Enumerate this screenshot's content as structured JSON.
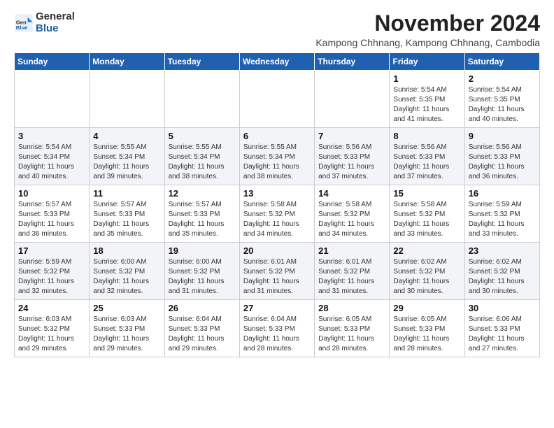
{
  "logo": {
    "general": "General",
    "blue": "Blue"
  },
  "header": {
    "month": "November 2024",
    "location": "Kampong Chhnang, Kampong Chhnang, Cambodia"
  },
  "weekdays": [
    "Sunday",
    "Monday",
    "Tuesday",
    "Wednesday",
    "Thursday",
    "Friday",
    "Saturday"
  ],
  "weeks": [
    [
      {
        "day": "",
        "info": ""
      },
      {
        "day": "",
        "info": ""
      },
      {
        "day": "",
        "info": ""
      },
      {
        "day": "",
        "info": ""
      },
      {
        "day": "",
        "info": ""
      },
      {
        "day": "1",
        "info": "Sunrise: 5:54 AM\nSunset: 5:35 PM\nDaylight: 11 hours and 41 minutes."
      },
      {
        "day": "2",
        "info": "Sunrise: 5:54 AM\nSunset: 5:35 PM\nDaylight: 11 hours and 40 minutes."
      }
    ],
    [
      {
        "day": "3",
        "info": "Sunrise: 5:54 AM\nSunset: 5:34 PM\nDaylight: 11 hours and 40 minutes."
      },
      {
        "day": "4",
        "info": "Sunrise: 5:55 AM\nSunset: 5:34 PM\nDaylight: 11 hours and 39 minutes."
      },
      {
        "day": "5",
        "info": "Sunrise: 5:55 AM\nSunset: 5:34 PM\nDaylight: 11 hours and 38 minutes."
      },
      {
        "day": "6",
        "info": "Sunrise: 5:55 AM\nSunset: 5:34 PM\nDaylight: 11 hours and 38 minutes."
      },
      {
        "day": "7",
        "info": "Sunrise: 5:56 AM\nSunset: 5:33 PM\nDaylight: 11 hours and 37 minutes."
      },
      {
        "day": "8",
        "info": "Sunrise: 5:56 AM\nSunset: 5:33 PM\nDaylight: 11 hours and 37 minutes."
      },
      {
        "day": "9",
        "info": "Sunrise: 5:56 AM\nSunset: 5:33 PM\nDaylight: 11 hours and 36 minutes."
      }
    ],
    [
      {
        "day": "10",
        "info": "Sunrise: 5:57 AM\nSunset: 5:33 PM\nDaylight: 11 hours and 36 minutes."
      },
      {
        "day": "11",
        "info": "Sunrise: 5:57 AM\nSunset: 5:33 PM\nDaylight: 11 hours and 35 minutes."
      },
      {
        "day": "12",
        "info": "Sunrise: 5:57 AM\nSunset: 5:33 PM\nDaylight: 11 hours and 35 minutes."
      },
      {
        "day": "13",
        "info": "Sunrise: 5:58 AM\nSunset: 5:32 PM\nDaylight: 11 hours and 34 minutes."
      },
      {
        "day": "14",
        "info": "Sunrise: 5:58 AM\nSunset: 5:32 PM\nDaylight: 11 hours and 34 minutes."
      },
      {
        "day": "15",
        "info": "Sunrise: 5:58 AM\nSunset: 5:32 PM\nDaylight: 11 hours and 33 minutes."
      },
      {
        "day": "16",
        "info": "Sunrise: 5:59 AM\nSunset: 5:32 PM\nDaylight: 11 hours and 33 minutes."
      }
    ],
    [
      {
        "day": "17",
        "info": "Sunrise: 5:59 AM\nSunset: 5:32 PM\nDaylight: 11 hours and 32 minutes."
      },
      {
        "day": "18",
        "info": "Sunrise: 6:00 AM\nSunset: 5:32 PM\nDaylight: 11 hours and 32 minutes."
      },
      {
        "day": "19",
        "info": "Sunrise: 6:00 AM\nSunset: 5:32 PM\nDaylight: 11 hours and 31 minutes."
      },
      {
        "day": "20",
        "info": "Sunrise: 6:01 AM\nSunset: 5:32 PM\nDaylight: 11 hours and 31 minutes."
      },
      {
        "day": "21",
        "info": "Sunrise: 6:01 AM\nSunset: 5:32 PM\nDaylight: 11 hours and 31 minutes."
      },
      {
        "day": "22",
        "info": "Sunrise: 6:02 AM\nSunset: 5:32 PM\nDaylight: 11 hours and 30 minutes."
      },
      {
        "day": "23",
        "info": "Sunrise: 6:02 AM\nSunset: 5:32 PM\nDaylight: 11 hours and 30 minutes."
      }
    ],
    [
      {
        "day": "24",
        "info": "Sunrise: 6:03 AM\nSunset: 5:32 PM\nDaylight: 11 hours and 29 minutes."
      },
      {
        "day": "25",
        "info": "Sunrise: 6:03 AM\nSunset: 5:33 PM\nDaylight: 11 hours and 29 minutes."
      },
      {
        "day": "26",
        "info": "Sunrise: 6:04 AM\nSunset: 5:33 PM\nDaylight: 11 hours and 29 minutes."
      },
      {
        "day": "27",
        "info": "Sunrise: 6:04 AM\nSunset: 5:33 PM\nDaylight: 11 hours and 28 minutes."
      },
      {
        "day": "28",
        "info": "Sunrise: 6:05 AM\nSunset: 5:33 PM\nDaylight: 11 hours and 28 minutes."
      },
      {
        "day": "29",
        "info": "Sunrise: 6:05 AM\nSunset: 5:33 PM\nDaylight: 11 hours and 28 minutes."
      },
      {
        "day": "30",
        "info": "Sunrise: 6:06 AM\nSunset: 5:33 PM\nDaylight: 11 hours and 27 minutes."
      }
    ]
  ]
}
